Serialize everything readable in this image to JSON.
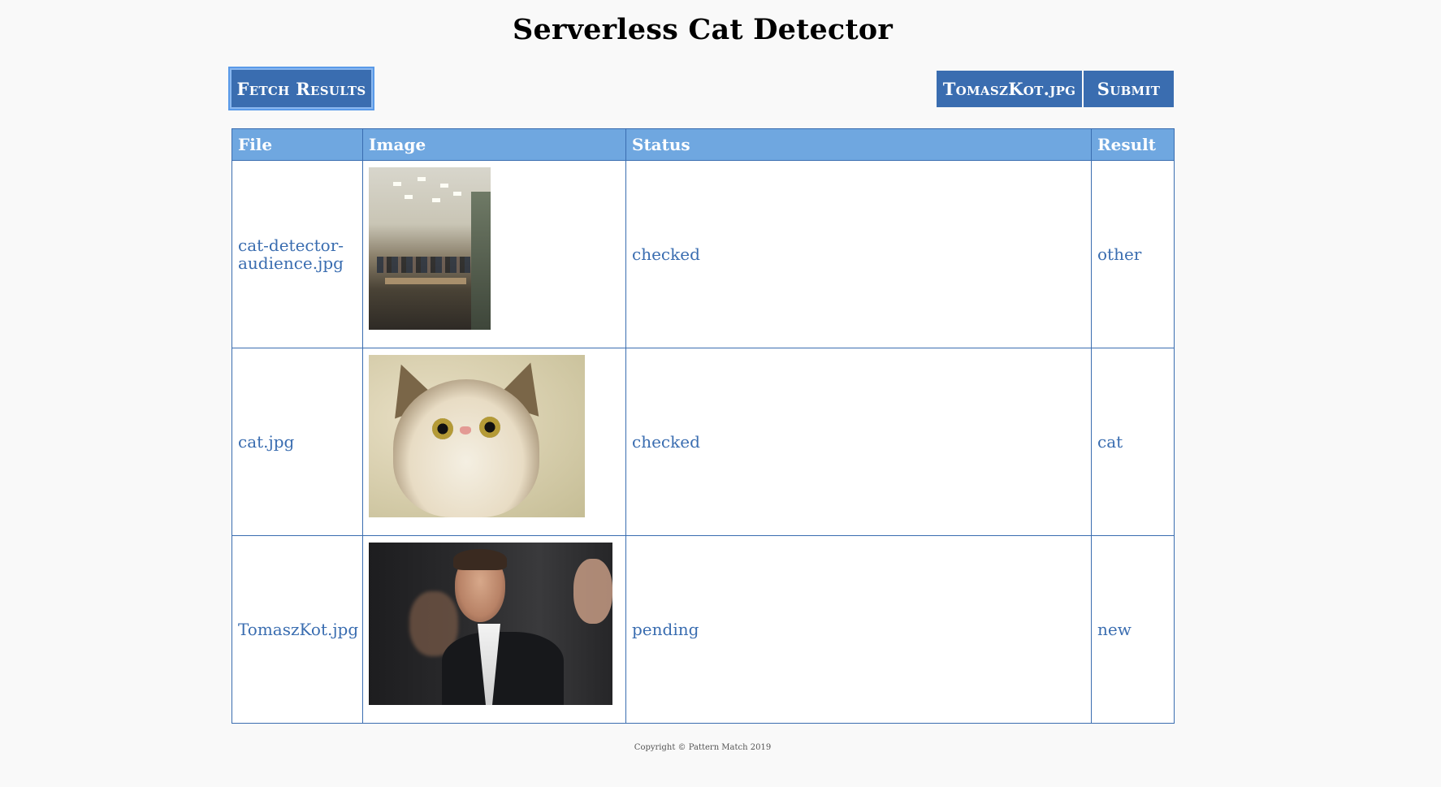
{
  "header": {
    "title": "Serverless Cat Detector"
  },
  "toolbar": {
    "fetch_label": "Fetch Results",
    "file_label": "TomaszKot.jpg",
    "submit_label": "Submit"
  },
  "table": {
    "columns": [
      "File",
      "Image",
      "Status",
      "Result"
    ],
    "rows": [
      {
        "file": "cat-detector-audience.jpg",
        "status": "checked",
        "result": "other",
        "image": "classroom-audience-photo"
      },
      {
        "file": "cat.jpg",
        "status": "checked",
        "result": "cat",
        "image": "surprised-cat-photo"
      },
      {
        "file": "TomaszKot.jpg",
        "status": "pending",
        "result": "new",
        "image": "man-in-suit-photo"
      }
    ]
  },
  "footer": {
    "copyright": "Copyright © Pattern Match 2019"
  },
  "colors": {
    "accent": "#3a6db0",
    "header_bg": "#6fa7e0",
    "page_bg": "#f9f9f9"
  }
}
